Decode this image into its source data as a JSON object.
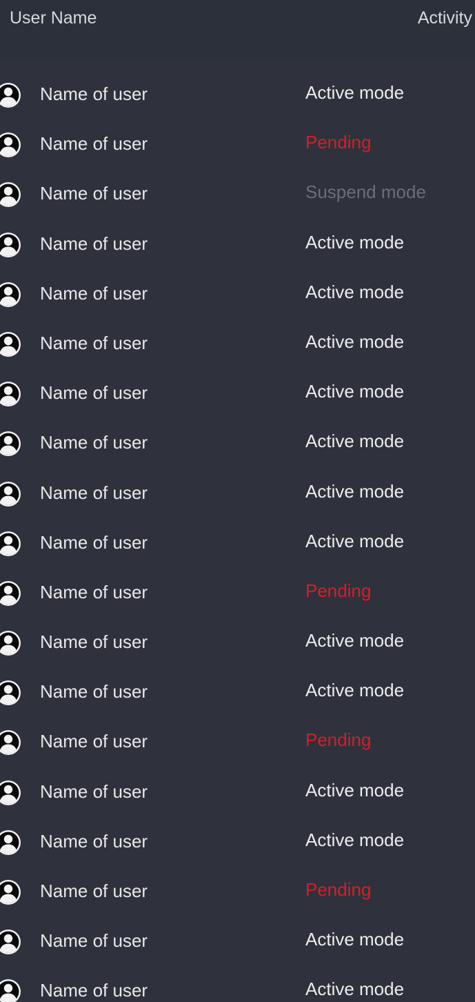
{
  "header": {
    "user_name_label": "User Name",
    "activity_label": "Activity"
  },
  "colors": {
    "background": "#2f323c",
    "header_background": "#2c303a",
    "active": "#ececee",
    "pending": "#d31f2a",
    "suspend": "#6b6e76"
  },
  "icons": {
    "avatar": "user-avatar-icon"
  },
  "rows": [
    {
      "name": "Name of user",
      "status": "Active mode",
      "state": "active"
    },
    {
      "name": "Name of user",
      "status": "Pending",
      "state": "pending"
    },
    {
      "name": "Name of user",
      "status": "Suspend mode",
      "state": "suspend"
    },
    {
      "name": "Name of user",
      "status": "Active mode",
      "state": "active"
    },
    {
      "name": "Name of user",
      "status": "Active mode",
      "state": "active"
    },
    {
      "name": "Name of user",
      "status": "Active mode",
      "state": "active"
    },
    {
      "name": "Name of user",
      "status": "Active mode",
      "state": "active"
    },
    {
      "name": "Name of user",
      "status": "Active mode",
      "state": "active"
    },
    {
      "name": "Name of user",
      "status": "Active mode",
      "state": "active"
    },
    {
      "name": "Name of user",
      "status": "Active mode",
      "state": "active"
    },
    {
      "name": "Name of user",
      "status": "Pending",
      "state": "pending"
    },
    {
      "name": "Name of user",
      "status": "Active mode",
      "state": "active"
    },
    {
      "name": "Name of user",
      "status": "Active mode",
      "state": "active"
    },
    {
      "name": "Name of user",
      "status": "Pending",
      "state": "pending"
    },
    {
      "name": "Name of user",
      "status": "Active mode",
      "state": "active"
    },
    {
      "name": "Name of user",
      "status": "Active mode",
      "state": "active"
    },
    {
      "name": "Name of user",
      "status": "Pending",
      "state": "pending"
    },
    {
      "name": "Name of user",
      "status": "Active mode",
      "state": "active"
    },
    {
      "name": "Name of user",
      "status": "Active mode",
      "state": "active"
    }
  ]
}
